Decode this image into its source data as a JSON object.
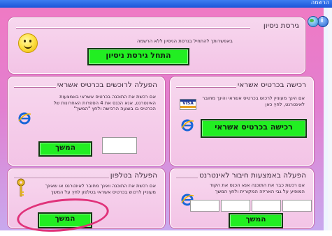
{
  "window": {
    "title": "הרשמה"
  },
  "icons": {
    "help": "help-icon",
    "globe": "globe-icon",
    "smiley": "smiley-icon",
    "browser": "internet-explorer-icon",
    "card": "visa-card-icon",
    "key": "key-icon"
  },
  "trial": {
    "title": "גירסת ניסיון",
    "text": "באפשרותך להתחיל בגרסת הניסיון ללא הרשמה",
    "button": "התחל גירסת ניסיון"
  },
  "card_purchase": {
    "title": "רכישה בכרטיס אשראי",
    "text": "אם הינך מעוניין לרכוש בכרטיס אשראי והינך מחובר לאינטרנט, לחץ כאן",
    "button": "רכישה בכרטיס אשראי"
  },
  "card_activation": {
    "title": "הפעלה לרוכשים בכרטיס אשראי",
    "text": "אם רכשת את התוכנה בכרטיס אשראי באמצעות האינטרנט, אנא הכנס את 4 הספרות האחרונות של הכרטיס בו בוצעה הרכישה ולחץ \"המשך\"",
    "button": "המשך"
  },
  "internet_activation": {
    "title": "הפעלה באמצעות חיבור לאינטרנט",
    "text": "אם רכשת כבר את התוכנה אנא הכנס את הקוד המופיע על גבי האריזה המקורית ולחץ המשך",
    "button": "המשך"
  },
  "phone_activation": {
    "title": "הפעלה בטלפון",
    "text": "אם רכשת את התוכנה ואינך מחובר לאינטרנט או שאינך מעוניין לרכוש בכרטיס אשראי בטלפון לחץ על המשך",
    "button": "המשך"
  },
  "colors": {
    "background_top": "#ef7ac4",
    "background_bottom": "#c8a9ee",
    "button_green": "#22ee22",
    "annotation_circle": "#e0327a"
  }
}
